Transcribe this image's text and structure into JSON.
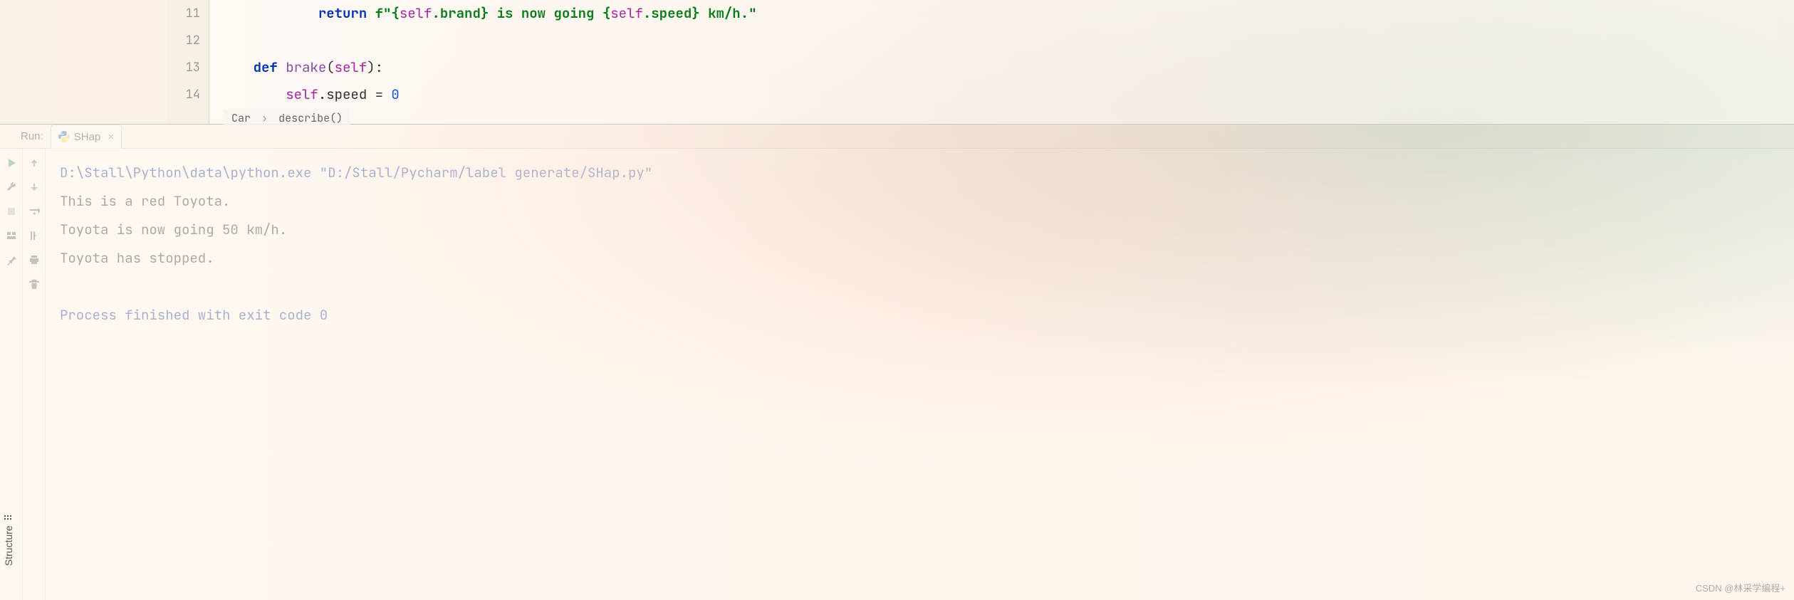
{
  "editor": {
    "line_numbers": [
      "11",
      "12",
      "13",
      "14"
    ],
    "lines": {
      "l11_return": "return",
      "l11_fprefix": " f\"",
      "l11_open": "{",
      "l11_self1": "self",
      "l11_dot1": ".brand",
      "l11_close1": "}",
      "l11_mid": " is now going ",
      "l11_open2": "{",
      "l11_self2": "self",
      "l11_dot2": ".speed",
      "l11_close2": "}",
      "l11_end": " km/h.\"",
      "l13_def": "def",
      "l13_name": " brake",
      "l13_open": "(",
      "l13_self": "self",
      "l13_close": "):",
      "l14_self": "self",
      "l14_attr": ".speed = ",
      "l14_val": "0"
    }
  },
  "breadcrumb": {
    "class": "Car",
    "method": "describe()"
  },
  "run_panel": {
    "label": "Run:",
    "tab_name": "SHap"
  },
  "console": {
    "command": "D:\\Stall\\Python\\data\\python.exe \"D:/Stall/Pycharm/label generate/SHap.py\"",
    "out1": "This is a red Toyota.",
    "out2": "Toyota is now going 50 km/h.",
    "out3": "Toyota has stopped.",
    "exit": "Process finished with exit code 0"
  },
  "side_tabs": {
    "structure": "Structure"
  },
  "watermark": "CSDN @林采学编程+"
}
